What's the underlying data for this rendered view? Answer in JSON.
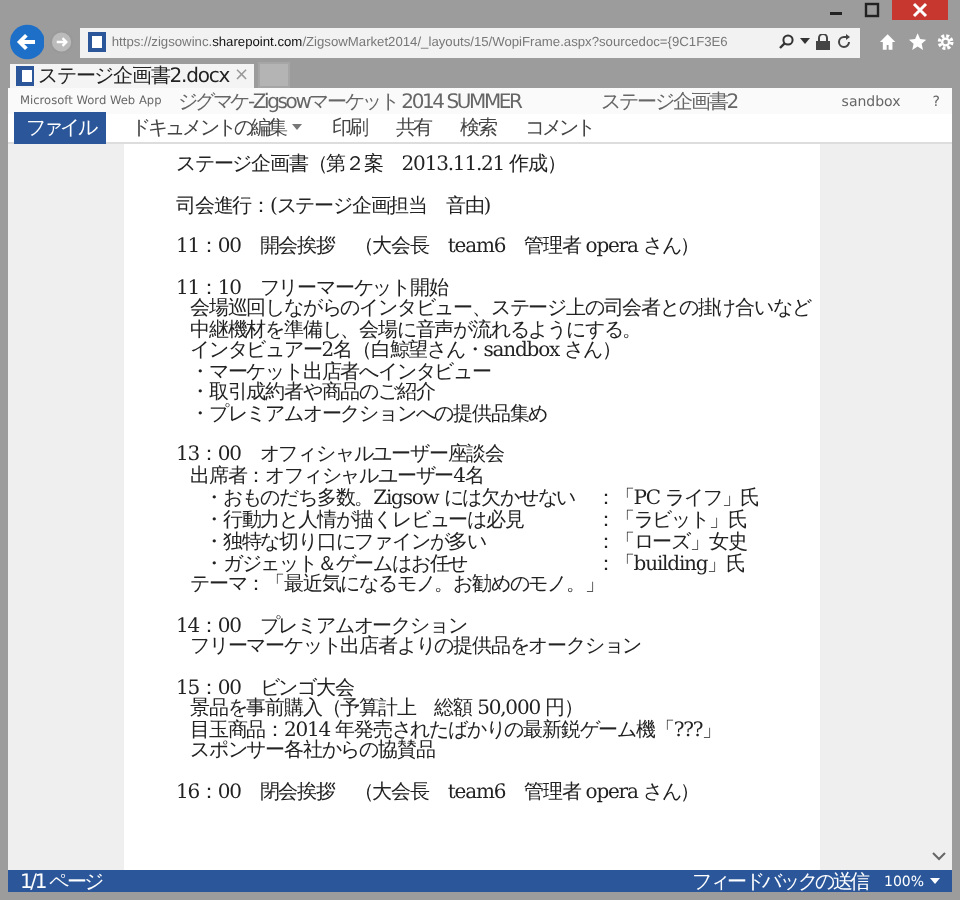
{
  "browser": {
    "url": {
      "before": "https://zigsowinc.",
      "domain": "sharepoint.com",
      "after": "/ZigsowMarket2014/_layouts/15/WopiFrame.aspx?sourcedoc={9C1F3E6"
    },
    "tab": {
      "title": "ステージ企画書2.docx",
      "close": "×"
    }
  },
  "app_bar": {
    "app_name": "Microsoft Word Web App",
    "site": "ジグマケ-Zigsowマーケット 2014 SUMMER",
    "document": "ステージ企画書2",
    "user": "sandbox",
    "help": "?"
  },
  "ribbon_tabs": [
    {
      "label": "ファイル",
      "selected": true,
      "dropdown": false
    },
    {
      "label": "ドキュメントの編集",
      "selected": false,
      "dropdown": true
    },
    {
      "label": "印刷",
      "selected": false,
      "dropdown": false
    },
    {
      "label": "共有",
      "selected": false,
      "dropdown": false
    },
    {
      "label": "検索",
      "selected": false,
      "dropdown": false
    },
    {
      "label": "コメント",
      "selected": false,
      "dropdown": false
    }
  ],
  "document": {
    "sections": [
      {
        "lines": [
          {
            "kind": "heading",
            "text": "ステージ企画書（第２案　2013.11.21 作成）"
          }
        ]
      },
      {
        "lines": [
          {
            "kind": "heading",
            "text": "司会進行：(ステージ企画担当　音由)"
          }
        ]
      },
      {
        "lines": [
          {
            "kind": "heading",
            "text": "11：00　開会挨拶　（大会長　team6　管理者 opera さん）"
          }
        ]
      },
      {
        "lines": [
          {
            "kind": "heading",
            "text": "11：10　フリーマーケット開始"
          },
          {
            "kind": "body",
            "text": "会場巡回しながらのインタビュー、ステージ上の司会者との掛け合いなど"
          },
          {
            "kind": "body",
            "text": "中継機材を準備し、会場に音声が流れるようにする。"
          },
          {
            "kind": "body",
            "text": "インタビュアー2名（白鯨望さん・sandbox さん）"
          },
          {
            "kind": "body",
            "text": "・マーケット出店者へインタビュー"
          },
          {
            "kind": "body",
            "text": "・取引成約者や商品のご紹介"
          },
          {
            "kind": "body",
            "text": "・プレミアムオークションへの提供品集め"
          }
        ]
      },
      {
        "lines": [
          {
            "kind": "heading",
            "text": "13：00　オフィシャルユーザー座談会"
          },
          {
            "kind": "body",
            "text": "出席者：オフィシャルユーザー4名"
          },
          {
            "kind": "pair",
            "text": "・おものだち多数。Zigsow には欠かせない",
            "note": "：「PC ライフ」氏"
          },
          {
            "kind": "pair",
            "text": "・行動力と人情が描くレビューは必見",
            "note": "：「ラビット」氏"
          },
          {
            "kind": "pair",
            "text": "・独特な切り口にファインが多い",
            "note": "：「ローズ」女史"
          },
          {
            "kind": "pair",
            "text": "・ガジェット＆ゲームはお任せ",
            "note": "：「building」氏"
          },
          {
            "kind": "body",
            "text": "テーマ：「最近気になるモノ。お勧めのモノ。」"
          }
        ]
      },
      {
        "lines": [
          {
            "kind": "heading",
            "text": "14：00　プレミアムオークション"
          },
          {
            "kind": "body",
            "text": "フリーマーケット出店者よりの提供品をオークション"
          }
        ]
      },
      {
        "lines": [
          {
            "kind": "heading",
            "text": "15：00　ビンゴ大会"
          },
          {
            "kind": "body",
            "text": "景品を事前購入（予算計上　総額 50,000 円）"
          },
          {
            "kind": "body",
            "text": "目玉商品：2014 年発売されたばかりの最新鋭ゲーム機「???」"
          },
          {
            "kind": "body",
            "text": "スポンサー各社からの協賛品"
          }
        ]
      },
      {
        "lines": [
          {
            "kind": "heading",
            "text": "16：00　閉会挨拶　（大会長　team6　管理者 opera さん）"
          }
        ]
      }
    ]
  },
  "status_bar": {
    "pages": "1/1 ページ",
    "feedback": "フィードバックの送信",
    "zoom": "100%"
  }
}
